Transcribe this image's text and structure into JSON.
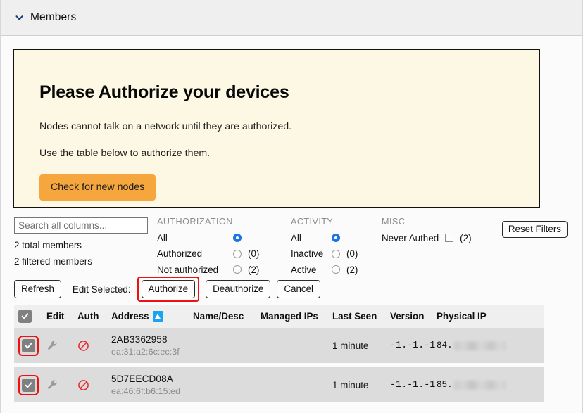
{
  "section": {
    "title": "Members",
    "chevron_icon": "chevron-down-icon"
  },
  "alert": {
    "heading": "Please Authorize your devices",
    "line1": "Nodes cannot talk on a network until they are authorized.",
    "line2": "Use the table below to authorize them.",
    "button_label": "Check for new nodes",
    "button_color": "#f5a63c",
    "background_color": "#fdf8e3"
  },
  "search": {
    "placeholder": "Search all columns...",
    "value": ""
  },
  "counts": {
    "total": "2 total members",
    "filtered": "2 filtered members"
  },
  "filters": {
    "authorization": {
      "title": "AUTHORIZATION",
      "options": [
        {
          "label": "All",
          "selected": true,
          "count": ""
        },
        {
          "label": "Authorized",
          "selected": false,
          "count": "(0)"
        },
        {
          "label": "Not authorized",
          "selected": false,
          "count": "(2)"
        }
      ]
    },
    "activity": {
      "title": "ACTIVITY",
      "options": [
        {
          "label": "All",
          "selected": true,
          "count": ""
        },
        {
          "label": "Inactive",
          "selected": false,
          "count": "(0)"
        },
        {
          "label": "Active",
          "selected": false,
          "count": "(2)"
        }
      ]
    },
    "misc": {
      "title": "MISC",
      "options": [
        {
          "label": "Never Authed",
          "checked": false,
          "count": "(2)"
        }
      ]
    },
    "reset_label": "Reset Filters"
  },
  "actions": {
    "refresh_label": "Refresh",
    "edit_selected_label": "Edit Selected:",
    "authorize_label": "Authorize",
    "deauthorize_label": "Deauthorize",
    "cancel_label": "Cancel",
    "highlight_color": "#ee1111"
  },
  "table": {
    "columns": [
      "",
      "Edit",
      "Auth",
      "Address",
      "Name/Desc",
      "Managed IPs",
      "Last Seen",
      "Version",
      "Physical IP"
    ],
    "sorted_column": "Address",
    "sort_direction": "ascending",
    "header_checkbox_checked": true,
    "rows": [
      {
        "selected": true,
        "edit_icon": "wrench-icon",
        "auth_icon": "no-entry-icon",
        "address": "2AB3362958",
        "mac": "ea:31:a2:6c:ec:3f",
        "name_desc": "",
        "managed_ips": "",
        "last_seen": "1 minute",
        "version": "-1.-1.-1",
        "physical_ip_prefix": "84.",
        "physical_ip_redacted": true
      },
      {
        "selected": true,
        "edit_icon": "wrench-icon",
        "auth_icon": "no-entry-icon",
        "address": "5D7EECD08A",
        "mac": "ea:46:6f:b6:15:ed",
        "name_desc": "",
        "managed_ips": "",
        "last_seen": "1 minute",
        "version": "-1.-1.-1",
        "physical_ip_prefix": "85.",
        "physical_ip_redacted": true
      }
    ]
  }
}
